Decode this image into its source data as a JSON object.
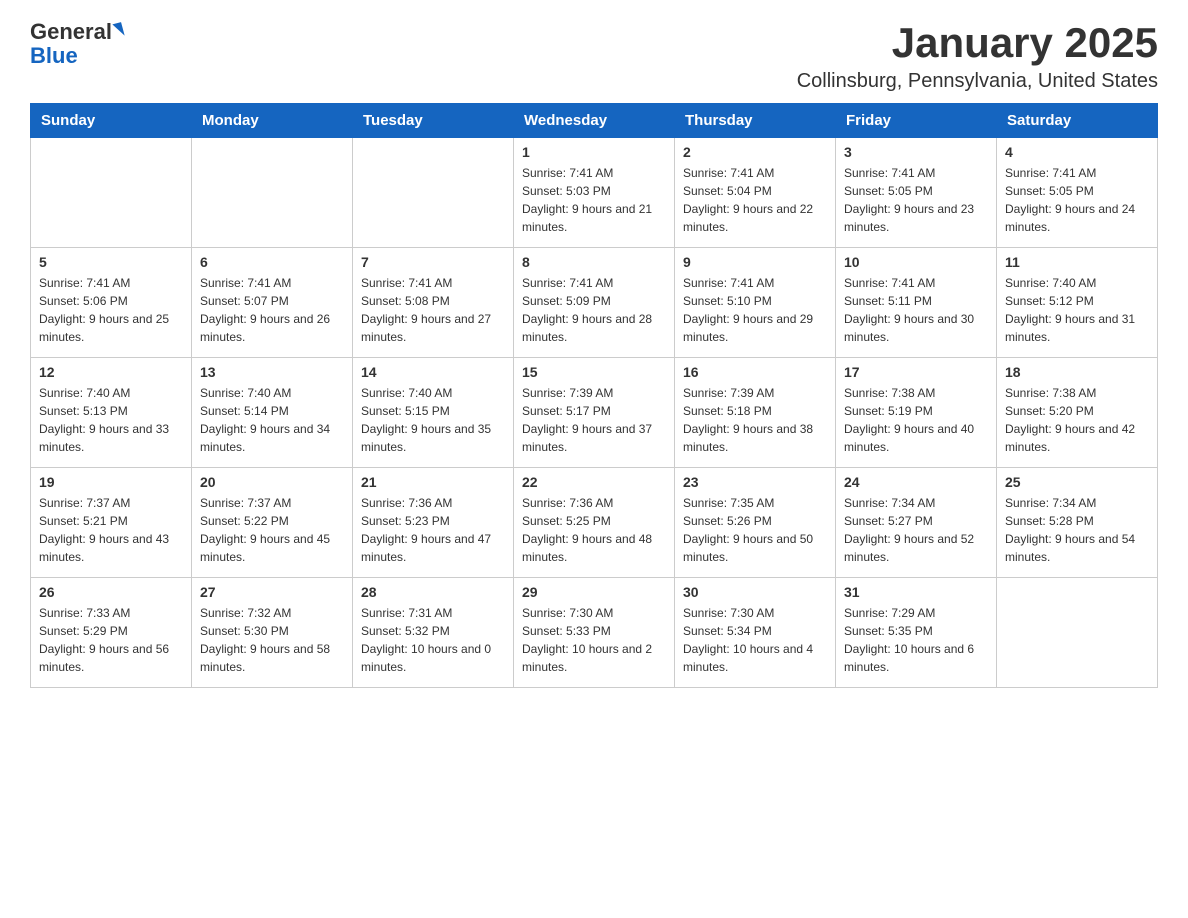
{
  "logo": {
    "text_general": "General",
    "text_blue": "Blue"
  },
  "header": {
    "title": "January 2025",
    "subtitle": "Collinsburg, Pennsylvania, United States"
  },
  "days_of_week": [
    "Sunday",
    "Monday",
    "Tuesday",
    "Wednesday",
    "Thursday",
    "Friday",
    "Saturday"
  ],
  "weeks": [
    [
      {
        "day": "",
        "sunrise": "",
        "sunset": "",
        "daylight": ""
      },
      {
        "day": "",
        "sunrise": "",
        "sunset": "",
        "daylight": ""
      },
      {
        "day": "",
        "sunrise": "",
        "sunset": "",
        "daylight": ""
      },
      {
        "day": "1",
        "sunrise": "Sunrise: 7:41 AM",
        "sunset": "Sunset: 5:03 PM",
        "daylight": "Daylight: 9 hours and 21 minutes."
      },
      {
        "day": "2",
        "sunrise": "Sunrise: 7:41 AM",
        "sunset": "Sunset: 5:04 PM",
        "daylight": "Daylight: 9 hours and 22 minutes."
      },
      {
        "day": "3",
        "sunrise": "Sunrise: 7:41 AM",
        "sunset": "Sunset: 5:05 PM",
        "daylight": "Daylight: 9 hours and 23 minutes."
      },
      {
        "day": "4",
        "sunrise": "Sunrise: 7:41 AM",
        "sunset": "Sunset: 5:05 PM",
        "daylight": "Daylight: 9 hours and 24 minutes."
      }
    ],
    [
      {
        "day": "5",
        "sunrise": "Sunrise: 7:41 AM",
        "sunset": "Sunset: 5:06 PM",
        "daylight": "Daylight: 9 hours and 25 minutes."
      },
      {
        "day": "6",
        "sunrise": "Sunrise: 7:41 AM",
        "sunset": "Sunset: 5:07 PM",
        "daylight": "Daylight: 9 hours and 26 minutes."
      },
      {
        "day": "7",
        "sunrise": "Sunrise: 7:41 AM",
        "sunset": "Sunset: 5:08 PM",
        "daylight": "Daylight: 9 hours and 27 minutes."
      },
      {
        "day": "8",
        "sunrise": "Sunrise: 7:41 AM",
        "sunset": "Sunset: 5:09 PM",
        "daylight": "Daylight: 9 hours and 28 minutes."
      },
      {
        "day": "9",
        "sunrise": "Sunrise: 7:41 AM",
        "sunset": "Sunset: 5:10 PM",
        "daylight": "Daylight: 9 hours and 29 minutes."
      },
      {
        "day": "10",
        "sunrise": "Sunrise: 7:41 AM",
        "sunset": "Sunset: 5:11 PM",
        "daylight": "Daylight: 9 hours and 30 minutes."
      },
      {
        "day": "11",
        "sunrise": "Sunrise: 7:40 AM",
        "sunset": "Sunset: 5:12 PM",
        "daylight": "Daylight: 9 hours and 31 minutes."
      }
    ],
    [
      {
        "day": "12",
        "sunrise": "Sunrise: 7:40 AM",
        "sunset": "Sunset: 5:13 PM",
        "daylight": "Daylight: 9 hours and 33 minutes."
      },
      {
        "day": "13",
        "sunrise": "Sunrise: 7:40 AM",
        "sunset": "Sunset: 5:14 PM",
        "daylight": "Daylight: 9 hours and 34 minutes."
      },
      {
        "day": "14",
        "sunrise": "Sunrise: 7:40 AM",
        "sunset": "Sunset: 5:15 PM",
        "daylight": "Daylight: 9 hours and 35 minutes."
      },
      {
        "day": "15",
        "sunrise": "Sunrise: 7:39 AM",
        "sunset": "Sunset: 5:17 PM",
        "daylight": "Daylight: 9 hours and 37 minutes."
      },
      {
        "day": "16",
        "sunrise": "Sunrise: 7:39 AM",
        "sunset": "Sunset: 5:18 PM",
        "daylight": "Daylight: 9 hours and 38 minutes."
      },
      {
        "day": "17",
        "sunrise": "Sunrise: 7:38 AM",
        "sunset": "Sunset: 5:19 PM",
        "daylight": "Daylight: 9 hours and 40 minutes."
      },
      {
        "day": "18",
        "sunrise": "Sunrise: 7:38 AM",
        "sunset": "Sunset: 5:20 PM",
        "daylight": "Daylight: 9 hours and 42 minutes."
      }
    ],
    [
      {
        "day": "19",
        "sunrise": "Sunrise: 7:37 AM",
        "sunset": "Sunset: 5:21 PM",
        "daylight": "Daylight: 9 hours and 43 minutes."
      },
      {
        "day": "20",
        "sunrise": "Sunrise: 7:37 AM",
        "sunset": "Sunset: 5:22 PM",
        "daylight": "Daylight: 9 hours and 45 minutes."
      },
      {
        "day": "21",
        "sunrise": "Sunrise: 7:36 AM",
        "sunset": "Sunset: 5:23 PM",
        "daylight": "Daylight: 9 hours and 47 minutes."
      },
      {
        "day": "22",
        "sunrise": "Sunrise: 7:36 AM",
        "sunset": "Sunset: 5:25 PM",
        "daylight": "Daylight: 9 hours and 48 minutes."
      },
      {
        "day": "23",
        "sunrise": "Sunrise: 7:35 AM",
        "sunset": "Sunset: 5:26 PM",
        "daylight": "Daylight: 9 hours and 50 minutes."
      },
      {
        "day": "24",
        "sunrise": "Sunrise: 7:34 AM",
        "sunset": "Sunset: 5:27 PM",
        "daylight": "Daylight: 9 hours and 52 minutes."
      },
      {
        "day": "25",
        "sunrise": "Sunrise: 7:34 AM",
        "sunset": "Sunset: 5:28 PM",
        "daylight": "Daylight: 9 hours and 54 minutes."
      }
    ],
    [
      {
        "day": "26",
        "sunrise": "Sunrise: 7:33 AM",
        "sunset": "Sunset: 5:29 PM",
        "daylight": "Daylight: 9 hours and 56 minutes."
      },
      {
        "day": "27",
        "sunrise": "Sunrise: 7:32 AM",
        "sunset": "Sunset: 5:30 PM",
        "daylight": "Daylight: 9 hours and 58 minutes."
      },
      {
        "day": "28",
        "sunrise": "Sunrise: 7:31 AM",
        "sunset": "Sunset: 5:32 PM",
        "daylight": "Daylight: 10 hours and 0 minutes."
      },
      {
        "day": "29",
        "sunrise": "Sunrise: 7:30 AM",
        "sunset": "Sunset: 5:33 PM",
        "daylight": "Daylight: 10 hours and 2 minutes."
      },
      {
        "day": "30",
        "sunrise": "Sunrise: 7:30 AM",
        "sunset": "Sunset: 5:34 PM",
        "daylight": "Daylight: 10 hours and 4 minutes."
      },
      {
        "day": "31",
        "sunrise": "Sunrise: 7:29 AM",
        "sunset": "Sunset: 5:35 PM",
        "daylight": "Daylight: 10 hours and 6 minutes."
      },
      {
        "day": "",
        "sunrise": "",
        "sunset": "",
        "daylight": ""
      }
    ]
  ]
}
